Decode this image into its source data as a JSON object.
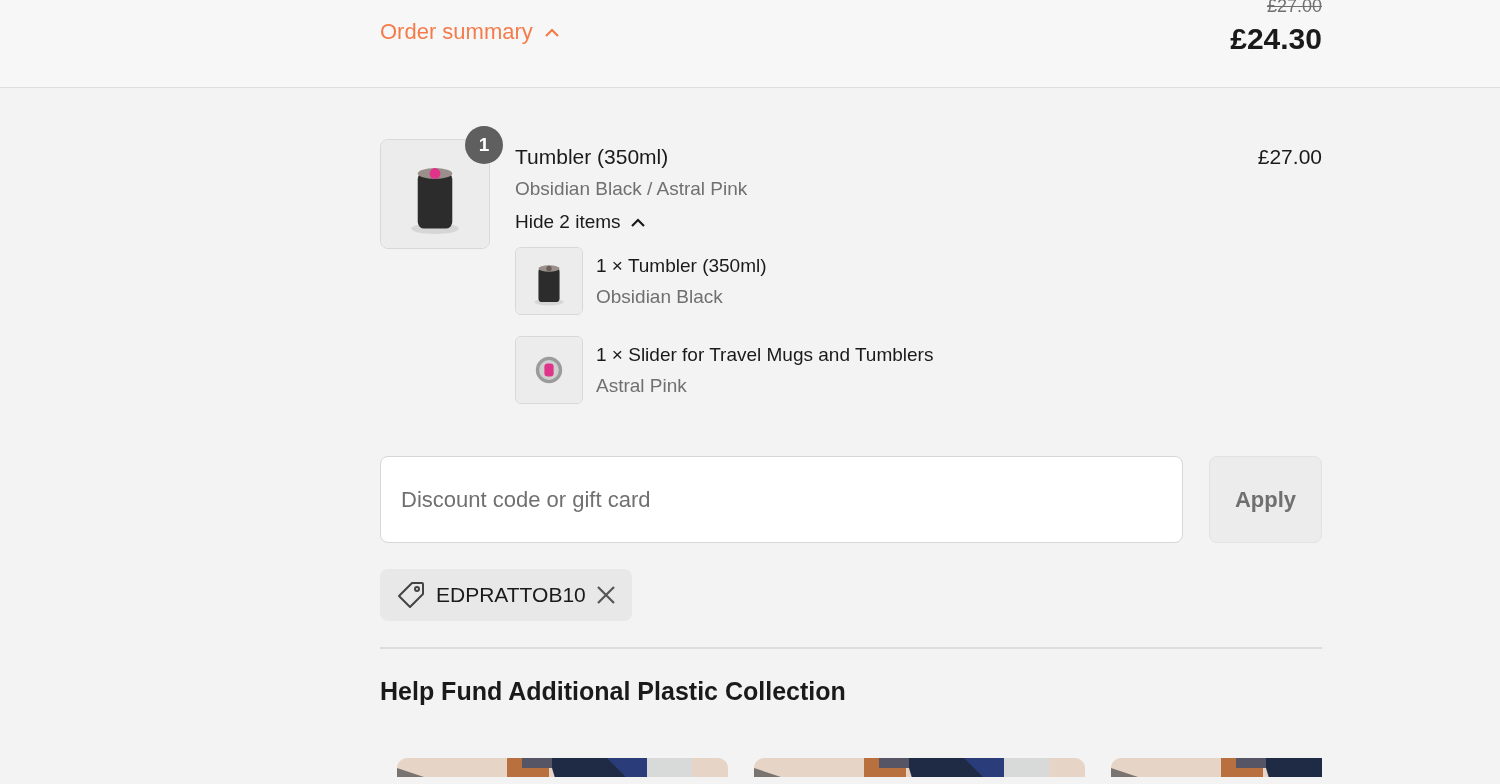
{
  "summary_bar": {
    "title": "Order summary",
    "expanded": true,
    "original_price": "£27.00",
    "total": "£24.30"
  },
  "line_item": {
    "quantity": "1",
    "name": "Tumbler (350ml)",
    "variant": "Obsidian Black / Astral Pink",
    "price": "£27.00",
    "toggle_label": "Hide 2 items",
    "expanded": true,
    "components": [
      {
        "name": "1 × Tumbler (350ml)",
        "variant": "Obsidian Black",
        "kind": "tumbler"
      },
      {
        "name": "1 × Slider for Travel Mugs and Tumblers",
        "variant": "Astral Pink",
        "kind": "slider"
      }
    ]
  },
  "discount": {
    "placeholder": "Discount code or gift card",
    "apply_label": "Apply"
  },
  "applied_codes": [
    {
      "code": "EDPRATTOB10"
    }
  ],
  "donation": {
    "heading": "Help Fund Additional Plastic Collection"
  }
}
